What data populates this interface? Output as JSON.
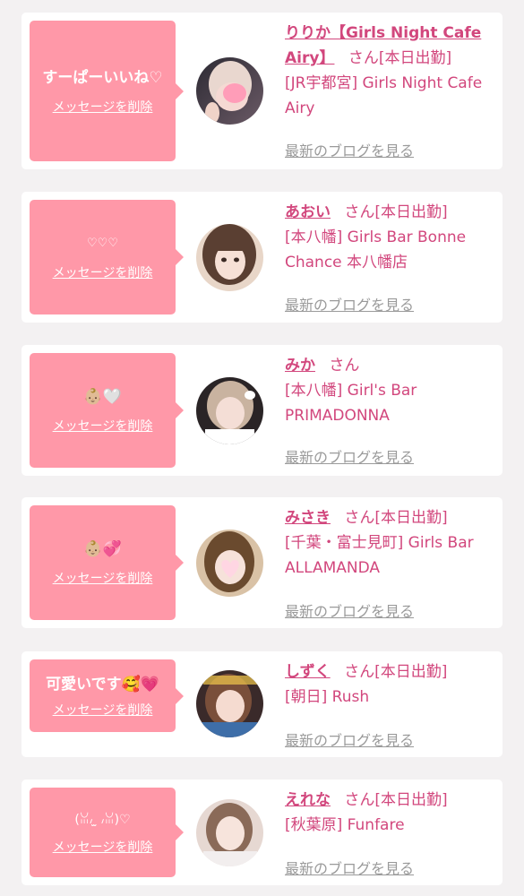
{
  "theme": {
    "accent": "#d2477d",
    "bubble": "#ff98a8",
    "link_gray": "#9a9a9a",
    "background": "#f3f1f2"
  },
  "labels": {
    "delete_message": "メッセージを削除",
    "view_blog": "最新のブログを見る",
    "honorific": "さん"
  },
  "items": [
    {
      "message": "すーぱーいいね♡",
      "name": "りりか【Girls Night Cafe Airy】",
      "status": "[本日出勤]",
      "shop": "[JR宇都宮] Girls Night Cafe Airy",
      "avatar_icon": "girl-photo-avatar"
    },
    {
      "message": "♡♡♡",
      "name": "あおい",
      "status": "[本日出勤]",
      "shop": "[本八幡] Girls Bar Bonne Chance 本八幡店",
      "avatar_icon": "girl-photo-avatar"
    },
    {
      "message": "👶🏼🤍",
      "name": "みか",
      "status": "",
      "shop": "[本八幡] Girl's Bar PRIMADONNA",
      "avatar_icon": "girl-photo-avatar"
    },
    {
      "message": "👶🏼💞",
      "name": "みさき",
      "status": "[本日出勤]",
      "shop": "[千葉・富士見町] Girls Bar ALLAMANDA",
      "avatar_icon": "girl-photo-avatar"
    },
    {
      "message": "可愛いです🥰💗",
      "name": "しずく",
      "status": "[本日出勤]",
      "shop": "[朝日] Rush",
      "avatar_icon": "girl-photo-avatar"
    },
    {
      "message": "(ꈍ៸ ̫ ៸ꈍ)♡",
      "name": "えれな",
      "status": "[本日出勤]",
      "shop": "[秋葉原] Funfare",
      "avatar_icon": "girl-photo-avatar"
    }
  ]
}
